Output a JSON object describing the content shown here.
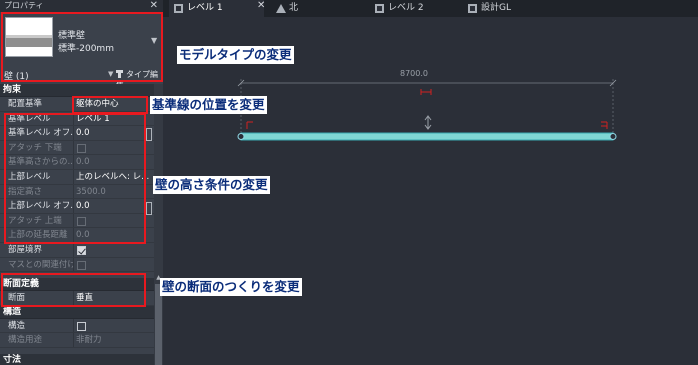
{
  "panel": {
    "title": "プロパティ",
    "close": "✕",
    "type_family": "標準壁",
    "type_name": "標準-200mm",
    "instance_label": "壁 (1)",
    "type_edit_label": "タイプ編集"
  },
  "groups": {
    "constraints": {
      "header": "拘束",
      "rows": [
        {
          "label": "配置基準",
          "value": "躯体の中心"
        },
        {
          "label": "基準レベル",
          "value": "レベル 1"
        },
        {
          "label": "基準レベル オフ...",
          "value": "0.0"
        },
        {
          "label": "アタッチ 下端",
          "value": ""
        },
        {
          "label": "基準高さからの...",
          "value": "0.0"
        },
        {
          "label": "上部レベル",
          "value": "上のレベルへ: レ..."
        },
        {
          "label": "指定高さ",
          "value": "3500.0"
        },
        {
          "label": "上部レベル オフ...",
          "value": "0.0"
        },
        {
          "label": "アタッチ 上端",
          "value": ""
        },
        {
          "label": "上部の延長距離",
          "value": "0.0"
        },
        {
          "label": "部屋境界",
          "value": ""
        },
        {
          "label": "マスとの関連付け",
          "value": ""
        }
      ]
    },
    "cross_section": {
      "header": "断面定義",
      "rows": [
        {
          "label": "断面",
          "value": "垂直"
        }
      ]
    },
    "structure": {
      "header": "構造",
      "rows": [
        {
          "label": "構造",
          "value": ""
        },
        {
          "label": "構造用途",
          "value": "非耐力"
        }
      ]
    },
    "dimensions": {
      "header": "寸法"
    }
  },
  "tabs": [
    {
      "label": "レベル 1",
      "active": true
    },
    {
      "label": "北",
      "active": false
    },
    {
      "label": "レベル 2",
      "active": false
    },
    {
      "label": "設計GL",
      "active": false
    }
  ],
  "canvas": {
    "dimension_value": "8700.0",
    "wall_color": "#7fd7d4"
  },
  "annotations": {
    "model_type": "モデルタイプの変更",
    "baseline": "基準線の位置を変更",
    "height_conditions": "壁の高さ条件の変更",
    "cross_section": "壁の断面のつくりを変更"
  },
  "colors": {
    "annotation_border": "#e8191f",
    "annotation_text": "#0b2d7a"
  }
}
